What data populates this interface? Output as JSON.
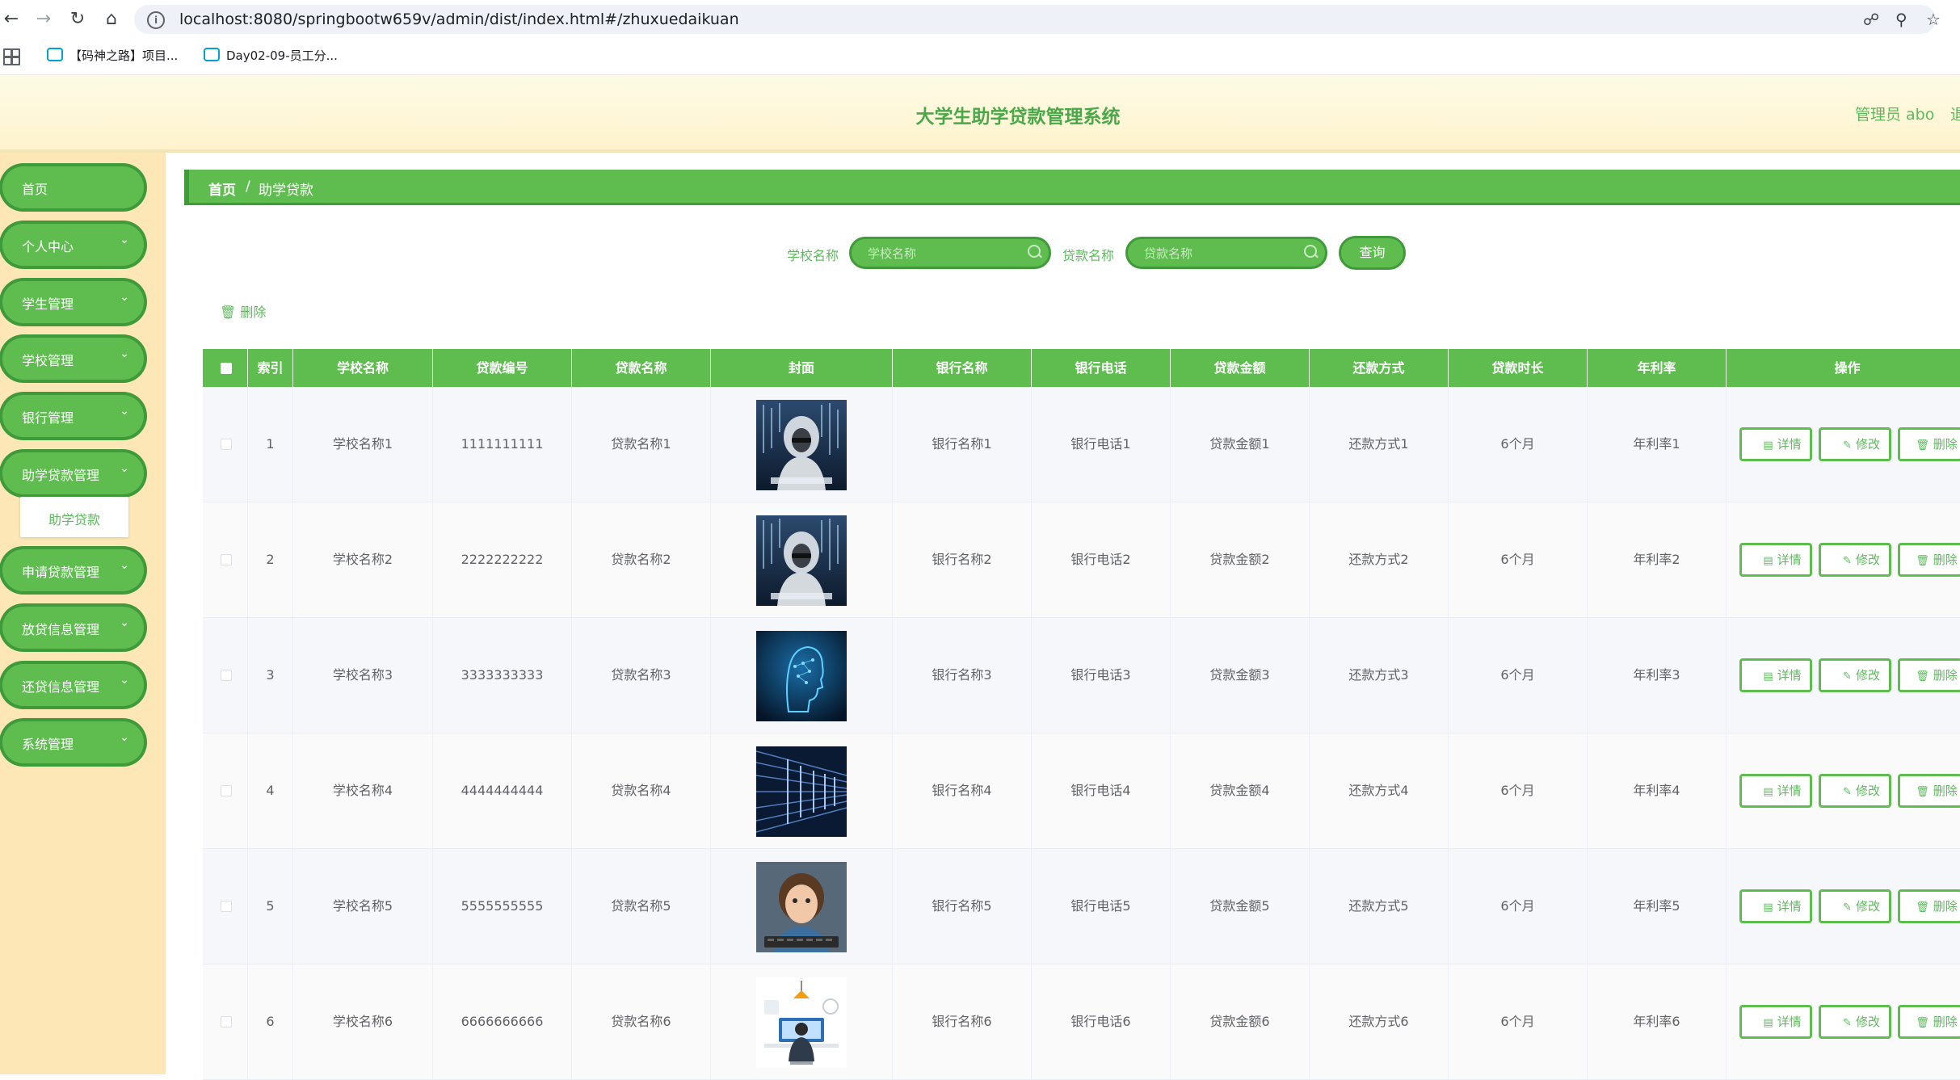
{
  "browser": {
    "url": "localhost:8080/springbootw659v/admin/dist/index.html#/zhuxuedaikuan",
    "bookmarks": [
      "【码神之路】项目...",
      "Day02-09-员工分..."
    ]
  },
  "header": {
    "title": "大学生助学贷款管理系统",
    "user": "管理员 abo",
    "logout": "退出"
  },
  "sidebar": {
    "items": [
      {
        "label": "首页",
        "has_children": false
      },
      {
        "label": "个人中心",
        "has_children": true
      },
      {
        "label": "学生管理",
        "has_children": true
      },
      {
        "label": "学校管理",
        "has_children": true
      },
      {
        "label": "银行管理",
        "has_children": true
      },
      {
        "label": "助学贷款管理",
        "has_children": true
      },
      {
        "label": "申请贷款管理",
        "has_children": true
      },
      {
        "label": "放贷信息管理",
        "has_children": true
      },
      {
        "label": "还贷信息管理",
        "has_children": true
      },
      {
        "label": "系统管理",
        "has_children": true
      }
    ],
    "submenu_active": "助学贷款"
  },
  "breadcrumb": {
    "home": "首页",
    "separator": "/",
    "current": "助学贷款"
  },
  "search": {
    "school_label": "学校名称",
    "school_placeholder": "学校名称",
    "loan_label": "贷款名称",
    "loan_placeholder": "贷款名称",
    "query_label": "查询"
  },
  "toolbar": {
    "delete_label": "删除"
  },
  "table": {
    "columns": [
      "索引",
      "学校名称",
      "贷款编号",
      "贷款名称",
      "封面",
      "银行名称",
      "银行电话",
      "贷款金额",
      "还款方式",
      "贷款时长",
      "年利率",
      "操作"
    ],
    "actions": {
      "detail": "详情",
      "edit": "修改",
      "delete": "删除"
    },
    "rows": [
      {
        "index": "1",
        "school": "学校名称1",
        "loan_no": "1111111111",
        "loan_name": "贷款名称1",
        "cover": "hooded-figure-code",
        "bank": "银行名称1",
        "phone": "银行电话1",
        "amount": "贷款金额1",
        "repay": "还款方式1",
        "duration": "6个月",
        "rate": "年利率1"
      },
      {
        "index": "2",
        "school": "学校名称2",
        "loan_no": "2222222222",
        "loan_name": "贷款名称2",
        "cover": "hooded-figure-code",
        "bank": "银行名称2",
        "phone": "银行电话2",
        "amount": "贷款金额2",
        "repay": "还款方式2",
        "duration": "6个月",
        "rate": "年利率2"
      },
      {
        "index": "3",
        "school": "学校名称3",
        "loan_no": "3333333333",
        "loan_name": "贷款名称3",
        "cover": "digital-head",
        "bank": "银行名称3",
        "phone": "银行电话3",
        "amount": "贷款金额3",
        "repay": "还款方式3",
        "duration": "6个月",
        "rate": "年利率3"
      },
      {
        "index": "4",
        "school": "学校名称4",
        "loan_no": "4444444444",
        "loan_name": "贷款名称4",
        "cover": "data-tunnel",
        "bank": "银行名称4",
        "phone": "银行电话4",
        "amount": "贷款金额4",
        "repay": "还款方式4",
        "duration": "6个月",
        "rate": "年利率4"
      },
      {
        "index": "5",
        "school": "学校名称5",
        "loan_no": "5555555555",
        "loan_name": "贷款名称5",
        "cover": "boy-keyboard",
        "bank": "银行名称5",
        "phone": "银行电话5",
        "amount": "贷款金额5",
        "repay": "还款方式5",
        "duration": "6个月",
        "rate": "年利率5"
      },
      {
        "index": "6",
        "school": "学校名称6",
        "loan_no": "6666666666",
        "loan_name": "贷款名称6",
        "cover": "desk-illustration",
        "bank": "银行名称6",
        "phone": "银行电话6",
        "amount": "贷款金额6",
        "repay": "还款方式6",
        "duration": "6个月",
        "rate": "年利率6"
      }
    ]
  },
  "colors": {
    "accent": "#5fbd50",
    "accent_dark": "#3f9a3a",
    "sidebar_bg": "#fde7b6",
    "text_green": "#5cba5c"
  }
}
